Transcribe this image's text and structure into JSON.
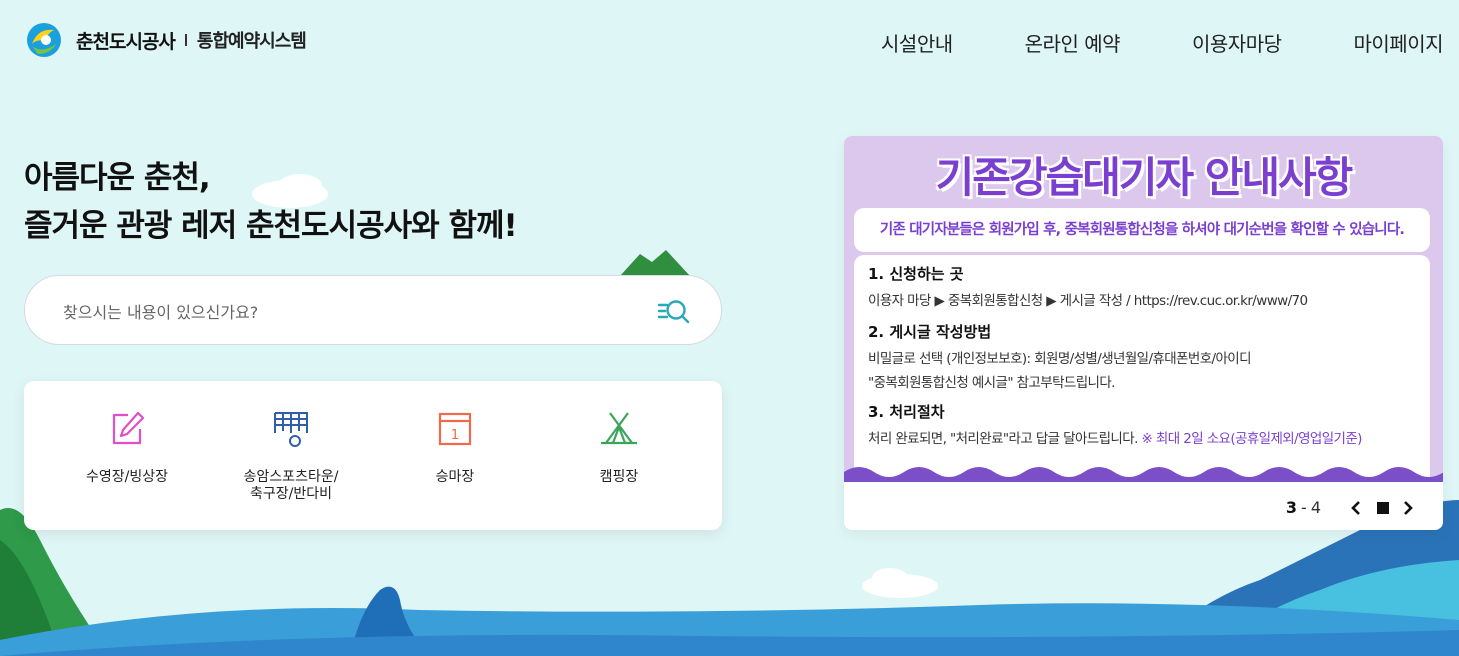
{
  "header": {
    "logo_name": "춘천도시공사",
    "logo_sub": "통합예약시스템",
    "nav": [
      "시설안내",
      "온라인 예약",
      "이용자마당",
      "마이페이지"
    ]
  },
  "hero": {
    "line1": "아름다운 춘천,",
    "line2": "즐거운 관광 레저 춘천도시공사와 함께!"
  },
  "search": {
    "placeholder": "찾으시는 내용이 있으신가요?"
  },
  "facilities": [
    {
      "label": "수영장/빙상장",
      "icon": "edit-icon",
      "color": "#e04fc4"
    },
    {
      "label": "송암스포츠타운/\n축구장/반다비",
      "icon": "soccer-goal-icon",
      "color": "#2f5fa8"
    },
    {
      "label": "승마장",
      "icon": "calendar-icon",
      "color": "#ef6a4a"
    },
    {
      "label": "캠핑장",
      "icon": "tent-icon",
      "color": "#3aa65a"
    }
  ],
  "notice": {
    "headline": "기존강습대기자 안내사항",
    "sub": "기존 대기자분들은 회원가입 후, 중복회원통합신청을 하셔야 대기순번을 확인할 수 있습니다.",
    "sections": [
      {
        "head": "1. 신청하는 곳",
        "lines": [
          "이용자 마당 ▶ 중복회원통합신청 ▶ 게시글 작성  /  https://rev.cuc.or.kr/www/70"
        ]
      },
      {
        "head": "2. 게시글 작성방법",
        "lines": [
          "비밀글로 선택 (개인정보보호): 회원명/성별/생년월일/휴대폰번호/아이디",
          "\"중복회원통합신청 예시글\" 참고부탁드립니다."
        ]
      },
      {
        "head": "3. 처리절차",
        "lines": [
          "처리 완료되면, \"처리완료\"라고 답글 달아드립니다."
        ],
        "highlight": "※ 최대 2일 소요(공휴일제외/영업일기준)"
      }
    ],
    "pager": {
      "current": "3",
      "separator": "-",
      "total": "4"
    }
  },
  "colors": {
    "background": "#dff6f6",
    "accent_purple": "#7b3fd0",
    "wave_blue": "#3a8fd6"
  }
}
